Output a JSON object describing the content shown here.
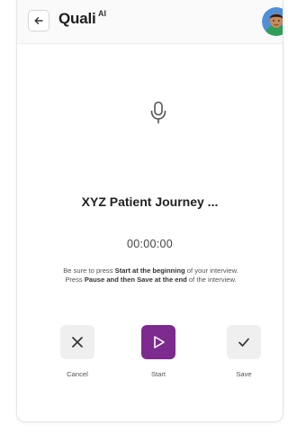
{
  "header": {
    "app_name": "Quali",
    "app_superscript": "AI"
  },
  "icons": {
    "back": "arrow-left-icon",
    "mic": "microphone-icon",
    "cancel": "x-icon",
    "start": "play-triangle-icon",
    "save": "checkmark-icon",
    "avatar": "user-avatar"
  },
  "recording": {
    "title": "XYZ Patient Journey ...",
    "timer": "00:00:00",
    "instructions": {
      "part1": "Be sure to press ",
      "bold1": "Start at the beginning",
      "part2": " of your interview. Press ",
      "bold2": "Pause and then Save at the end",
      "part3": " of the interview."
    }
  },
  "actions": {
    "cancel_label": "Cancel",
    "start_label": "Start",
    "save_label": "Save"
  },
  "colors": {
    "start_button": "#7d2a8f",
    "secondary_button": "#efefef",
    "header_bg": "#fafafa"
  }
}
